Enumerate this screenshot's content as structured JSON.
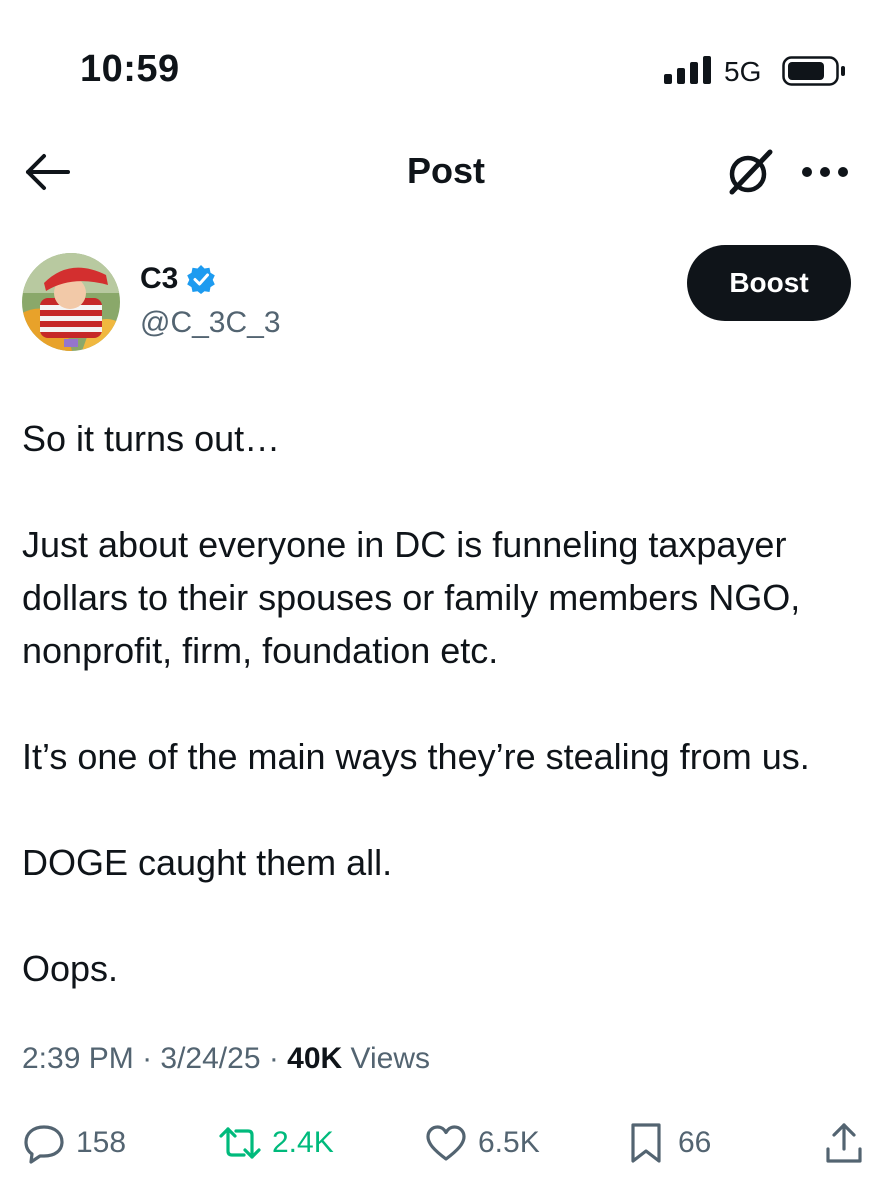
{
  "status_bar": {
    "time": "10:59",
    "network": "5G",
    "icons": [
      "signal-bars-icon",
      "battery-icon"
    ]
  },
  "header": {
    "title": "Post",
    "icons": [
      "back-arrow-icon",
      "grok-icon",
      "more-icon"
    ]
  },
  "author": {
    "display_name": "C3",
    "handle": "@C_3C_3",
    "verified": true,
    "verified_color": "#1d9bf0"
  },
  "boost_label": "Boost",
  "tweet": {
    "paragraphs": [
      "So it turns out…",
      "Just about everyone in DC is funneling taxpayer dollars to their spouses or family members NGO, nonprofit, firm, foundation etc.",
      "It’s one of the main ways they’re stealing from us.",
      "DOGE caught them all.",
      "Oops."
    ]
  },
  "meta": {
    "time": "2:39 PM",
    "date": "3/24/25",
    "separator": " · ",
    "views_count": "40K",
    "views_label": " Views"
  },
  "actions": {
    "replies": "158",
    "reposts": "2.4K",
    "likes": "6.5K",
    "bookmarks": "66",
    "icons": [
      "reply-icon",
      "repost-icon",
      "like-icon",
      "bookmark-icon",
      "share-icon"
    ],
    "repost_color": "#00ba7c"
  },
  "colors": {
    "text_primary": "#0f1419",
    "text_secondary": "#536471",
    "button_dark": "#0f1419"
  }
}
